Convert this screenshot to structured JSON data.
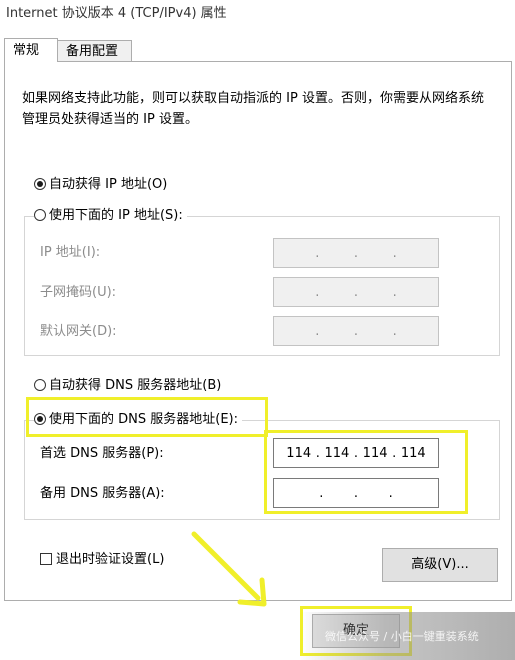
{
  "window": {
    "title": "Internet 协议版本 4 (TCP/IPv4) 属性"
  },
  "tabs": [
    {
      "label": "常规",
      "active": true
    },
    {
      "label": "备用配置",
      "active": false
    }
  ],
  "description": "如果网络支持此功能，则可以获取自动指派的 IP 设置。否则，你需要从网络系统管理员处获得适当的 IP 设置。",
  "ip": {
    "auto_label": "自动获得 IP 地址(O)",
    "auto_checked": true,
    "manual_label": "使用下面的 IP 地址(S):",
    "manual_checked": false,
    "fields": [
      {
        "label": "IP 地址(I):",
        "value": ". . ."
      },
      {
        "label": "子网掩码(U):",
        "value": ". . ."
      },
      {
        "label": "默认网关(D):",
        "value": ". . ."
      }
    ]
  },
  "dns": {
    "auto_label": "自动获得 DNS 服务器地址(B)",
    "auto_checked": false,
    "manual_label": "使用下面的 DNS 服务器地址(E):",
    "manual_checked": true,
    "preferred_label": "首选 DNS 服务器(P):",
    "preferred_octets": [
      "114",
      "114",
      "114",
      "114"
    ],
    "alternate_label": "备用 DNS 服务器(A):",
    "alternate_octets": [
      "",
      "",
      "",
      ""
    ]
  },
  "validate_label": "退出时验证设置(L)",
  "advanced_button": "高级(V)...",
  "ok_button": "确定",
  "watermark": "微信公众号 / 小白一键重装系统",
  "colors": {
    "highlight": "#f0ef2a",
    "disabled_text": "#8c8c8c"
  }
}
